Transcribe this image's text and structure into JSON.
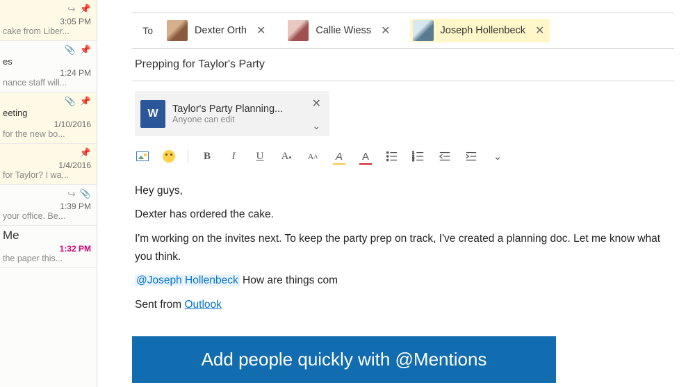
{
  "sidebar": {
    "items": [
      {
        "time": "3:05 PM",
        "title": "",
        "preview": "cake from Liber...",
        "reply": true,
        "attachment": false,
        "flag": "red",
        "selected": true
      },
      {
        "time": "1:24 PM",
        "title": "es",
        "preview": "nance staff will...",
        "reply": false,
        "attachment": true,
        "flag": "red",
        "selected": false
      },
      {
        "time": "1/10/2016",
        "title": "eeting",
        "preview": "for the new bo...",
        "reply": false,
        "attachment": true,
        "flag": "red",
        "selected": true
      },
      {
        "time": "1/4/2016",
        "title": "",
        "preview": "for Taylor? I wa...",
        "reply": false,
        "attachment": false,
        "flag": "red",
        "selected": true
      },
      {
        "time": "1:39 PM",
        "title": "",
        "preview": "your office. Be...",
        "reply": true,
        "attachment": true,
        "flag": "grey",
        "selected": false
      },
      {
        "time": "1:32 PM",
        "title": "Me",
        "preview": "the paper this...",
        "reply": false,
        "attachment": false,
        "flag": "me",
        "selected": false
      }
    ]
  },
  "compose": {
    "to_label": "To",
    "recipients": [
      {
        "name": "Dexter Orth",
        "highlight": false,
        "avatar": "av1"
      },
      {
        "name": "Callie Wiess",
        "highlight": false,
        "avatar": "av2"
      },
      {
        "name": "Joseph Hollenbeck",
        "highlight": true,
        "avatar": "av3"
      }
    ],
    "subject": "Prepping for Taylor's Party",
    "attachment": {
      "title": "Taylor's Party Planning...",
      "sub": "Anyone can edit"
    },
    "body": {
      "l1": "Hey guys,",
      "l2": "Dexter has ordered the cake.",
      "l3": "I'm working on the invites next. To keep the party prep on track, I've created a planning doc. Let me know what you think.",
      "mention": "@Joseph Hollenbeck",
      "l4rest": " How are things com",
      "sig_prefix": "Sent from ",
      "sig_link": "Outlook"
    },
    "promo": "Add people quickly with @Mentions"
  }
}
